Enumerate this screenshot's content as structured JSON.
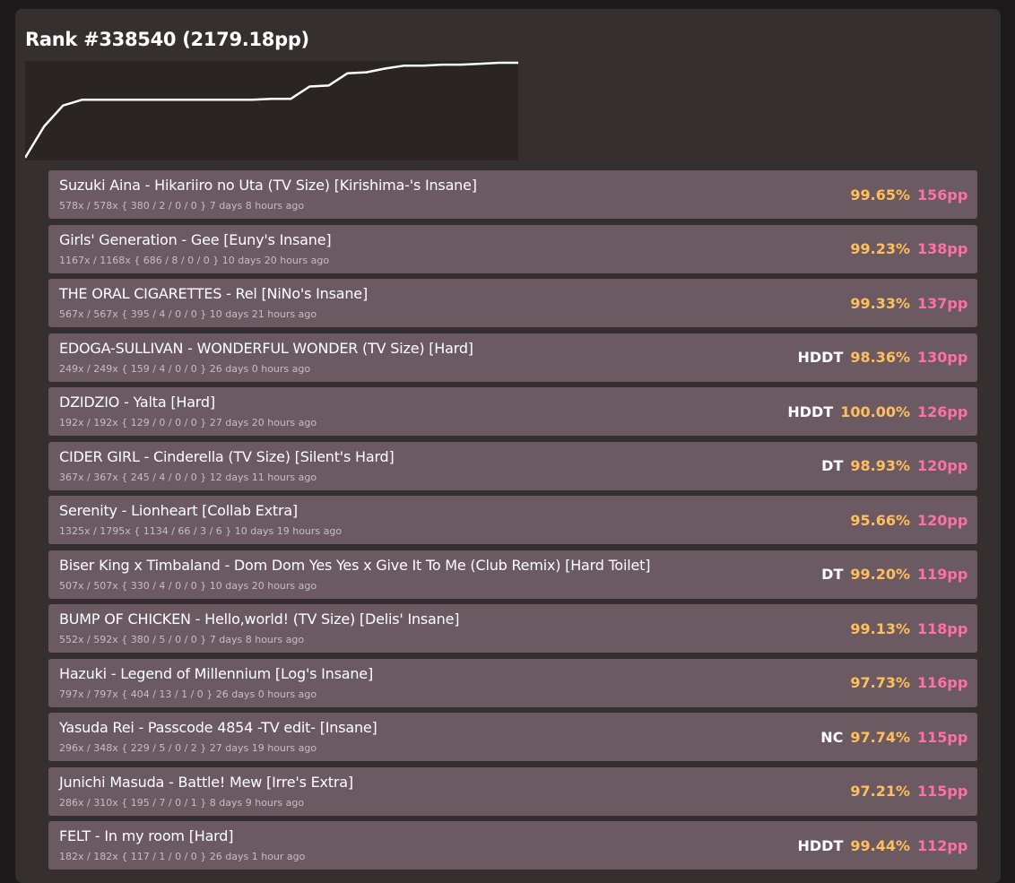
{
  "profile": {
    "title": "Rank #338540 (2179.18pp)"
  },
  "colors": {
    "accuracy": "#ffbf5c",
    "pp": "#ff6fa8",
    "row_bg": "#6b5a62",
    "panel_bg": "#362f30"
  },
  "rank_history": [
    0.0,
    0.33,
    0.55,
    0.61,
    0.61,
    0.61,
    0.61,
    0.61,
    0.61,
    0.61,
    0.61,
    0.61,
    0.61,
    0.62,
    0.62,
    0.75,
    0.76,
    0.89,
    0.9,
    0.94,
    0.97,
    0.97,
    0.98,
    0.98,
    0.99,
    1.0,
    1.0
  ],
  "scores": [
    {
      "song": "Suzuki Aina - Hikariiro no Uta (TV Size) [Kirishima-'s Insane]",
      "meta": "578x / 578x { 380 / 2 / 0 / 0 } 7 days 8 hours ago",
      "mods": "",
      "acc": "99.65%",
      "pp": "156pp"
    },
    {
      "song": "Girls' Generation - Gee [Euny's Insane]",
      "meta": "1167x / 1168x { 686 / 8 / 0 / 0 } 10 days 20 hours ago",
      "mods": "",
      "acc": "99.23%",
      "pp": "138pp"
    },
    {
      "song": "THE ORAL CIGARETTES - Rel [NiNo's Insane]",
      "meta": "567x / 567x { 395 / 4 / 0 / 0 } 10 days 21 hours ago",
      "mods": "",
      "acc": "99.33%",
      "pp": "137pp"
    },
    {
      "song": "EDOGA-SULLIVAN - WONDERFUL WONDER (TV Size) [Hard]",
      "meta": "249x / 249x { 159 / 4 / 0 / 0 } 26 days 0 hours ago",
      "mods": "HDDT",
      "acc": "98.36%",
      "pp": "130pp"
    },
    {
      "song": "DZIDZIO - Yalta [Hard]",
      "meta": "192x / 192x { 129 / 0 / 0 / 0 } 27 days 20 hours ago",
      "mods": "HDDT",
      "acc": "100.00%",
      "pp": "126pp"
    },
    {
      "song": "CIDER GIRL - Cinderella (TV Size) [Silent's Hard]",
      "meta": "367x / 367x { 245 / 4 / 0 / 0 } 12 days 11 hours ago",
      "mods": "DT",
      "acc": "98.93%",
      "pp": "120pp"
    },
    {
      "song": "Serenity - Lionheart [Collab Extra]",
      "meta": "1325x / 1795x { 1134 / 66 / 3 / 6 } 10 days 19 hours ago",
      "mods": "",
      "acc": "95.66%",
      "pp": "120pp"
    },
    {
      "song": "Biser King x Timbaland - Dom Dom Yes Yes x Give It To Me (Club Remix) [Hard Toilet]",
      "meta": "507x / 507x { 330 / 4 / 0 / 0 } 10 days 20 hours ago",
      "mods": "DT",
      "acc": "99.20%",
      "pp": "119pp"
    },
    {
      "song": "BUMP OF CHICKEN - Hello,world! (TV Size) [Delis' Insane]",
      "meta": "552x / 592x { 380 / 5 / 0 / 0 } 7 days 8 hours ago",
      "mods": "",
      "acc": "99.13%",
      "pp": "118pp"
    },
    {
      "song": "Hazuki - Legend of Millennium [Log's Insane]",
      "meta": "797x / 797x { 404 / 13 / 1 / 0 } 26 days 0 hours ago",
      "mods": "",
      "acc": "97.73%",
      "pp": "116pp"
    },
    {
      "song": "Yasuda Rei - Passcode 4854 -TV edit- [Insane]",
      "meta": "296x / 348x { 229 / 5 / 0 / 2 } 27 days 19 hours ago",
      "mods": "NC",
      "acc": "97.74%",
      "pp": "115pp"
    },
    {
      "song": "Junichi Masuda - Battle! Mew [Irre's Extra]",
      "meta": "286x / 310x { 195 / 7 / 0 / 1 } 8 days 9 hours ago",
      "mods": "",
      "acc": "97.21%",
      "pp": "115pp"
    },
    {
      "song": "FELT - In my room [Hard]",
      "meta": "182x / 182x { 117 / 1 / 0 / 0 } 26 days 1 hour ago",
      "mods": "HDDT",
      "acc": "99.44%",
      "pp": "112pp"
    }
  ]
}
